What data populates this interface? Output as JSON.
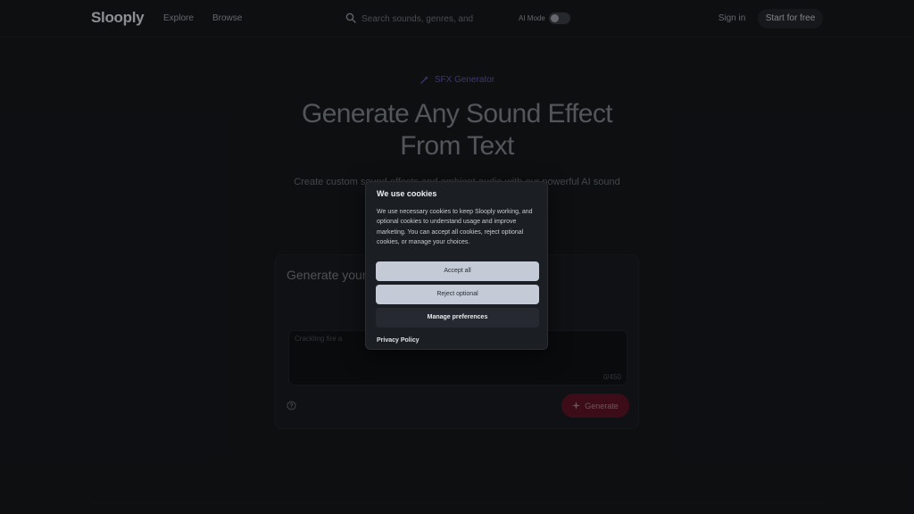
{
  "header": {
    "logo": "Slooply",
    "nav": [
      "Explore",
      "Browse"
    ],
    "search_placeholder": "Search sounds, genres, and",
    "ai_mode_label": "AI Mode",
    "ai_mode_on": false,
    "signin_label": "Sign in",
    "start_label": "Start for free"
  },
  "hero": {
    "badge": "SFX Generator",
    "title_line1": "Generate Any Sound Effect",
    "title_line2": "From Text",
    "subtitle": "Create custom sound effects and ambient audio with our powerful AI sound"
  },
  "card": {
    "title": "Generate your",
    "prompt_placeholder": "Crackling fire a",
    "char_count": "0/450",
    "generate_label": "Generate"
  },
  "cookie": {
    "title": "We use cookies",
    "body": "We use necessary cookies to keep Slooply working, and optional cookies to understand usage and improve marketing. You can accept all cookies, reject optional cookies, or manage your choices.",
    "accept_label": "Accept all",
    "reject_label": "Reject optional",
    "manage_label": "Manage preferences",
    "privacy_label": "Privacy Policy"
  },
  "colors": {
    "background": "#15171b",
    "accent_generate": "#5c1426",
    "badge": "#5d56a8",
    "button_light": "#c4cad6"
  }
}
